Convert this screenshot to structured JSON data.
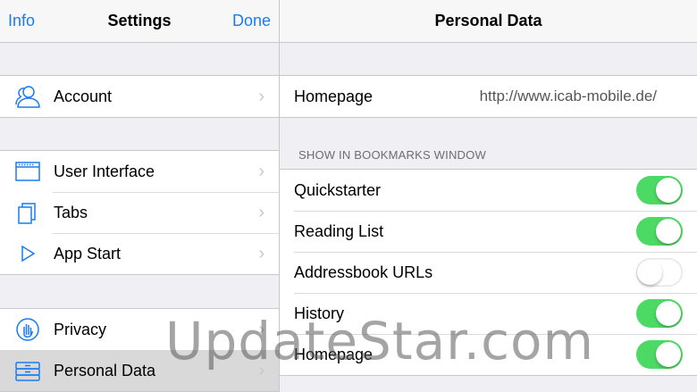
{
  "left_nav": {
    "info_label": "Info",
    "title": "Settings",
    "done_label": "Done"
  },
  "sidebar": {
    "groups": [
      {
        "items": [
          {
            "label": "Account",
            "icon": "person-icon"
          }
        ]
      },
      {
        "items": [
          {
            "label": "User Interface",
            "icon": "window-icon"
          },
          {
            "label": "Tabs",
            "icon": "tabs-icon"
          },
          {
            "label": "App Start",
            "icon": "play-icon"
          }
        ]
      },
      {
        "items": [
          {
            "label": "Privacy",
            "icon": "hand-icon"
          },
          {
            "label": "Personal Data",
            "icon": "drawer-icon",
            "selected": true
          }
        ]
      }
    ]
  },
  "detail": {
    "title": "Personal Data",
    "homepage": {
      "label": "Homepage",
      "value": "http://www.icab-mobile.de/"
    },
    "section_header": "SHOW IN BOOKMARKS WINDOW",
    "toggles": [
      {
        "label": "Quickstarter",
        "on": true
      },
      {
        "label": "Reading List",
        "on": true
      },
      {
        "label": "Addressbook URLs",
        "on": false
      },
      {
        "label": "History",
        "on": true
      },
      {
        "label": "Homepage",
        "on": true
      }
    ]
  },
  "watermark": "UpdateStar.com",
  "colors": {
    "accent": "#1a7cf0",
    "toggle_on": "#4cd964",
    "background": "#efeff4"
  }
}
